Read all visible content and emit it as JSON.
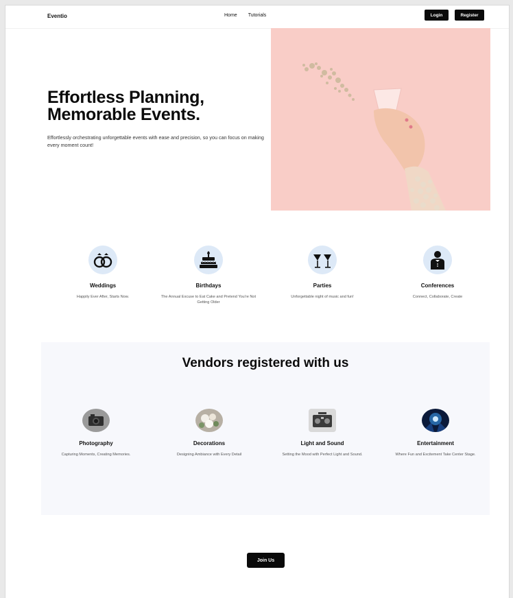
{
  "nav": {
    "brand": "Eventio",
    "links": [
      "Home",
      "Tutorials"
    ],
    "login_label": "Login",
    "register_label": "Register"
  },
  "hero": {
    "title_line1": "Effortless Planning,",
    "title_line2": "Memorable Events.",
    "subtitle": "Effortlessly orchestrating unforgettable events with ease and precision, so you can focus on making every moment count!",
    "image_icon": "champagne-glass-hand-image"
  },
  "categories": [
    {
      "title": "Weddings",
      "desc": "Happily Ever After, Starts Now.",
      "icon": "wedding-rings-icon"
    },
    {
      "title": "Birthdays",
      "desc": "The Annual Excuse to Eat Cake and Pretend You're Not Getting Older",
      "icon": "birthday-cake-icon"
    },
    {
      "title": "Parties",
      "desc": "Unforgettable night of music and fun!",
      "icon": "cocktail-glasses-icon"
    },
    {
      "title": "Conferences",
      "desc": "Connect, Collaborate, Create",
      "icon": "presenter-icon"
    }
  ],
  "vendors": {
    "title": "Vendors registered with us",
    "items": [
      {
        "title": "Photography",
        "desc": "Capturing Moments, Creating Memories.",
        "icon": "camera-image"
      },
      {
        "title": "Decorations",
        "desc": "Designing Ambiance with Every Detail",
        "icon": "flowers-image"
      },
      {
        "title": "Light and Sound",
        "desc": "Setting the Mood with Perfect Light and Sound.",
        "icon": "speaker-image"
      },
      {
        "title": "Entertainment",
        "desc": "Where Fun and Excitement Take Center Stage.",
        "icon": "stage-lights-image"
      }
    ]
  },
  "cta": {
    "join_label": "Join Us"
  },
  "colors": {
    "hero_bg": "#f9cdc7",
    "icon_bg": "#dde9f7",
    "button": "#0a0a0a",
    "vendors_bg": "#f7f8fc"
  }
}
